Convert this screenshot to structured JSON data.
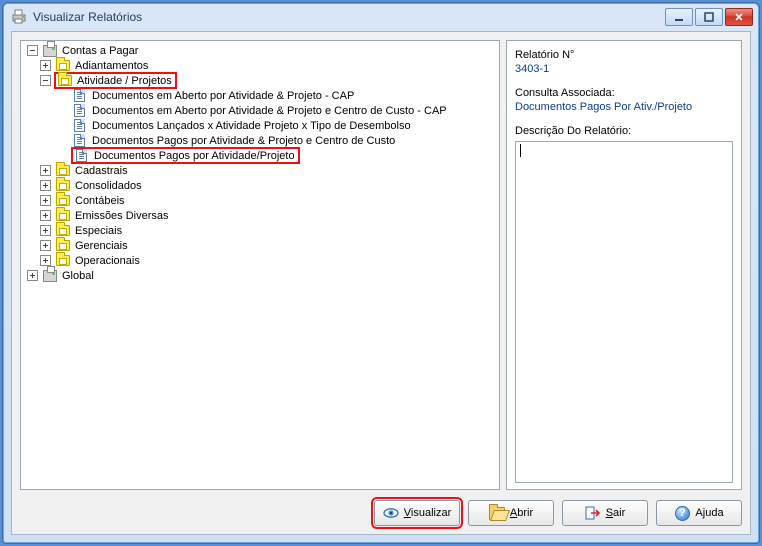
{
  "window": {
    "title": "Visualizar Relatórios"
  },
  "side": {
    "report_no_label": "Relatório N°",
    "report_no_value": "3403-1",
    "assoc_label": "Consulta Associada:",
    "assoc_value": "Documentos Pagos Por Ativ./Projeto",
    "desc_label": "Descrição Do Relatório:"
  },
  "buttons": {
    "visualizar_pre": "V",
    "visualizar_rest": "isualizar",
    "abrir_pre": "A",
    "abrir_rest": "brir",
    "sair_pre": "S",
    "sair_rest": "air",
    "ajuda": "Ajuda"
  },
  "tree": {
    "root": "Contas a Pagar",
    "adiantamentos": "Adiantamentos",
    "ativ_proj": "Atividade / Projetos",
    "ap_items": [
      "Documentos em Aberto por Atividade & Projeto - CAP",
      "Documentos em Aberto por Atividade & Projeto e Centro de Custo - CAP",
      "Documentos Lançados x Atividade Projeto x Tipo de Desembolso",
      "Documentos Pagos por Atividade & Projeto e Centro de Custo",
      "Documentos Pagos por Atividade/Projeto"
    ],
    "folders_rest": [
      "Cadastrais",
      "Consolidados",
      "Contábeis",
      "Emissões Diversas",
      "Especiais",
      "Gerenciais",
      "Operacionais"
    ],
    "global": "Global"
  }
}
